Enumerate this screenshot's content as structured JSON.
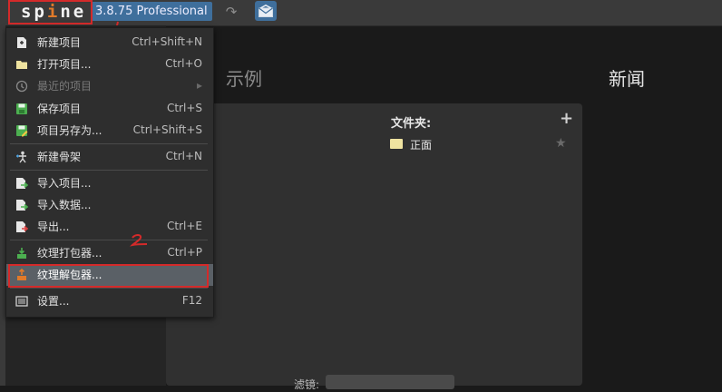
{
  "app": {
    "logo": "spine",
    "version": "3.8.75 Professional"
  },
  "welcome": {
    "examples_title": "示例",
    "news_title": "新闻",
    "folders_label": "文件夹:",
    "folder_item": "正面",
    "filter_label": "滤镜:"
  },
  "menu": {
    "items": [
      {
        "label": "新建项目",
        "shortcut": "Ctrl+Shift+N",
        "icon": "new-project-icon"
      },
      {
        "label": "打开项目...",
        "shortcut": "Ctrl+O",
        "icon": "folder-icon"
      },
      {
        "label": "最近的项目",
        "shortcut": "▸",
        "icon": "history-icon",
        "disabled": true
      },
      {
        "label": "保存项目",
        "shortcut": "Ctrl+S",
        "icon": "save-icon"
      },
      {
        "label": "项目另存为...",
        "shortcut": "Ctrl+Shift+S",
        "icon": "save-as-icon"
      },
      {
        "label": "新建骨架",
        "shortcut": "Ctrl+N",
        "icon": "skeleton-icon"
      },
      {
        "label": "导入项目...",
        "shortcut": "",
        "icon": "import-project-icon"
      },
      {
        "label": "导入数据...",
        "shortcut": "",
        "icon": "import-data-icon"
      },
      {
        "label": "导出...",
        "shortcut": "Ctrl+E",
        "icon": "export-icon"
      },
      {
        "label": "纹理打包器...",
        "shortcut": "Ctrl+P",
        "icon": "texture-packer-icon"
      },
      {
        "label": "纹理解包器...",
        "shortcut": "",
        "icon": "texture-unpacker-icon",
        "highlighted": true
      },
      {
        "label": "设置...",
        "shortcut": "F12",
        "icon": "settings-icon"
      }
    ]
  },
  "colors": {
    "accent": "#3f6f9c",
    "annotation": "#d42a2a",
    "logo_i": "#e07a2a"
  }
}
